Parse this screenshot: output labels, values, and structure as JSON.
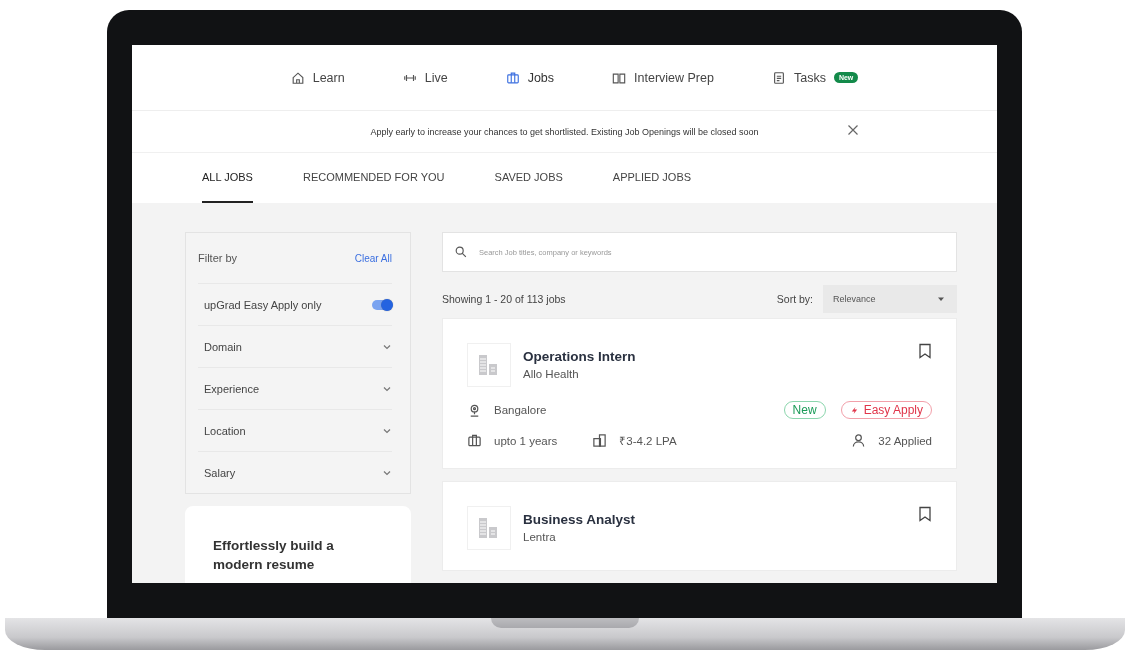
{
  "nav": {
    "items": [
      {
        "label": "Learn",
        "selected": false
      },
      {
        "label": "Live",
        "selected": false
      },
      {
        "label": "Jobs",
        "selected": true
      },
      {
        "label": "Interview Prep",
        "selected": false
      },
      {
        "label": "Tasks",
        "selected": false,
        "badge": "New"
      }
    ]
  },
  "banner": {
    "text": "Apply early to increase your chances to get shortlisted. Existing Job Openings will be closed soon"
  },
  "tabs": [
    {
      "label": "ALL JOBS",
      "selected": true
    },
    {
      "label": "RECOMMENDED FOR YOU",
      "selected": false
    },
    {
      "label": "SAVED JOBS",
      "selected": false
    },
    {
      "label": "APPLIED JOBS",
      "selected": false
    }
  ],
  "filters": {
    "title": "Filter by",
    "clear": "Clear All",
    "toggle": {
      "label": "upGrad Easy Apply only",
      "on": true
    },
    "dropdowns": [
      {
        "label": "Domain",
        "expanded": false
      },
      {
        "label": "Experience",
        "expanded": false
      },
      {
        "label": "Location",
        "expanded": false
      },
      {
        "label": "Salary",
        "expanded": false
      }
    ]
  },
  "promo": {
    "title": "Effortlessly build a modern resume"
  },
  "search": {
    "placeholder": "Search Job titles, company or keywords"
  },
  "results": {
    "summary": "Showing 1 - 20 of 113 jobs",
    "sort_label": "Sort by:",
    "sort_value": "Relevance"
  },
  "jobs": [
    {
      "title": "Operations Intern",
      "company": "Allo Health",
      "location": "Bangalore",
      "experience": "upto 1 years",
      "salary": "₹3-4.2 LPA",
      "badges": [
        {
          "label": "New",
          "kind": "new"
        },
        {
          "label": "Easy Apply",
          "kind": "easy"
        }
      ],
      "applied": "32 Applied",
      "saved": false
    },
    {
      "title": "Business Analyst",
      "company": "Lentra",
      "saved": false
    }
  ]
}
